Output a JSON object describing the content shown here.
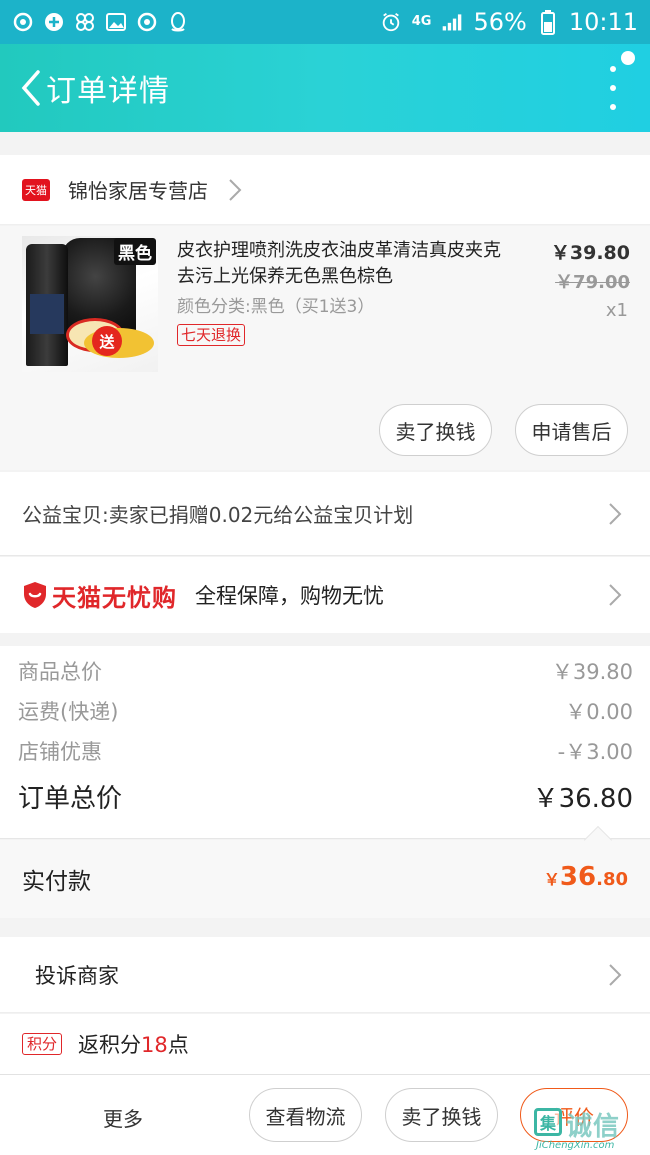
{
  "status_bar": {
    "battery_percent": "56%",
    "time": "10:11",
    "network": "4G"
  },
  "header": {
    "title": "订单详情"
  },
  "shop": {
    "badge": "天猫",
    "name": "锦怡家居专营店"
  },
  "product": {
    "title": "皮衣护理喷剂洗皮衣油皮革清洁真皮夹克去污上光保养无色黑色棕色",
    "spec": "颜色分类:黑色（买1送3）",
    "tag": "七天退换",
    "price": "￥39.80",
    "original_price": "￥79.00",
    "quantity": "x1",
    "image_tag": "黑色",
    "image_gift": "送",
    "actions": {
      "sell": "卖了换钱",
      "after_sale": "申请售后"
    }
  },
  "charity": {
    "text": "公益宝贝:卖家已捐赠0.02元给公益宝贝计划"
  },
  "guarantee": {
    "brand": "天猫无忧购",
    "desc": "全程保障，购物无忧"
  },
  "summary": {
    "rows": [
      {
        "label": "商品总价",
        "value": "￥39.80"
      },
      {
        "label": "运费(快递)",
        "value": "￥0.00"
      },
      {
        "label": "店铺优惠",
        "value": "-￥3.00"
      }
    ],
    "total_label": "订单总价",
    "total_value": "￥36.80"
  },
  "paid": {
    "label": "实付款",
    "currency": "￥",
    "integer": "36",
    "decimal": ".80"
  },
  "complain": {
    "label": "投诉商家"
  },
  "points": {
    "badge": "积分",
    "prefix": "返积分",
    "number": "18",
    "suffix": "点"
  },
  "bottom_bar": {
    "more": "更多",
    "track": "查看物流",
    "sell": "卖了换钱",
    "review": "评价"
  },
  "watermark": {
    "box": "集",
    "text": "诚信",
    "url": "JiChengXin.com"
  },
  "colors": {
    "brand_teal": "#22c9be",
    "tmall_red": "#e0272a",
    "accent_orange": "#f05a1a"
  }
}
